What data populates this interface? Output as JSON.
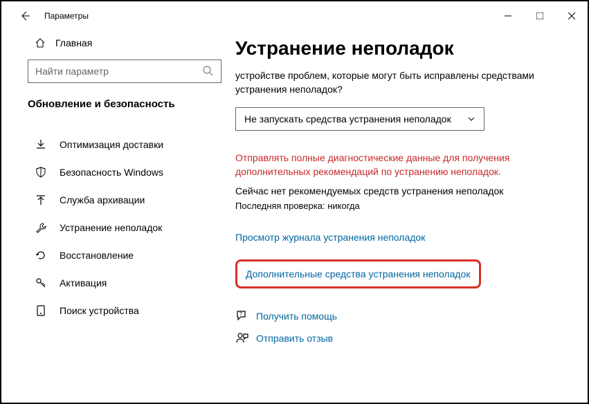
{
  "titlebar": {
    "app_name": "Параметры"
  },
  "sidebar": {
    "home_label": "Главная",
    "search_placeholder": "Найти параметр",
    "section_header": "Обновление и безопасность",
    "items": [
      {
        "label": "Оптимизация доставки"
      },
      {
        "label": "Безопасность Windows"
      },
      {
        "label": "Служба архивации"
      },
      {
        "label": "Устранение неполадок"
      },
      {
        "label": "Восстановление"
      },
      {
        "label": "Активация"
      },
      {
        "label": "Поиск устройства"
      }
    ]
  },
  "main": {
    "title": "Устранение неполадок",
    "subtitle": "устройстве проблем, которые могут быть исправлены средствами устранения неполадок?",
    "dropdown_value": "Не запускать средства устранения неполадок",
    "warning_text": "Отправлять полные диагностические данные для получения дополнительных рекомендаций по устранению неполадок.",
    "status_text": "Сейчас нет рекомендуемых средств устранения неполадок",
    "last_check": "Последняя проверка: никогда",
    "history_link": "Просмотр журнала устранения неполадок",
    "additional_link": "Дополнительные средства устранения неполадок",
    "help_link": "Получить помощь",
    "feedback_link": "Отправить отзыв"
  }
}
